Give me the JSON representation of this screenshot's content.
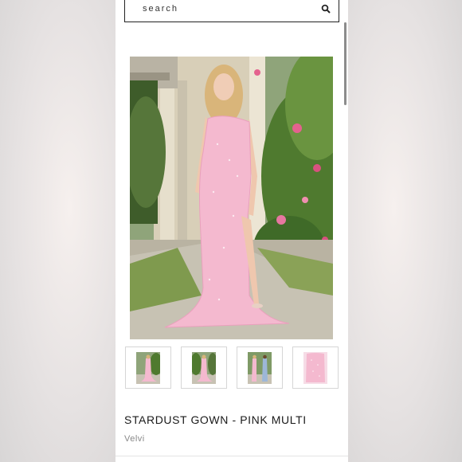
{
  "search": {
    "placeholder": "search",
    "icon": "search-icon"
  },
  "product": {
    "title": "STARDUST GOWN - PINK MULTI",
    "brand": "Velvi"
  },
  "gallery": {
    "thumbnails": [
      "thumbnail-1",
      "thumbnail-2",
      "thumbnail-3",
      "thumbnail-4"
    ]
  },
  "colors": {
    "dress_pink": "#f4b9cf",
    "foliage": "#4f7a2f",
    "text": "#1a1a1a",
    "brand_text": "#888888"
  }
}
